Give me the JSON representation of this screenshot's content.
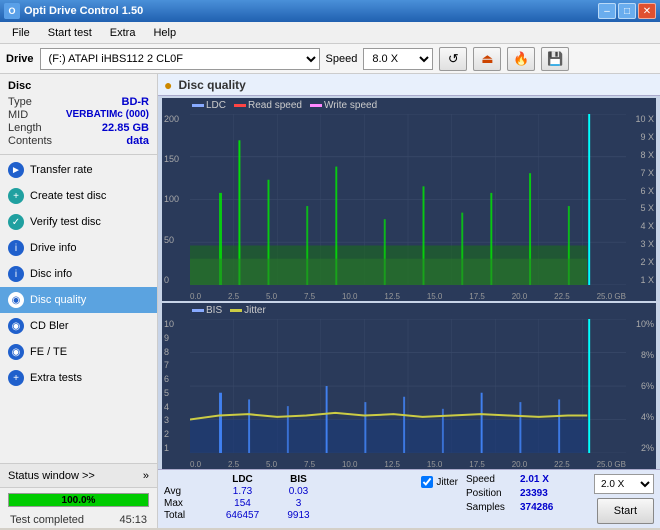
{
  "titlebar": {
    "icon": "●",
    "title": "Opti Drive Control 1.50",
    "min": "–",
    "max": "□",
    "close": "✕"
  },
  "menu": {
    "items": [
      "File",
      "Start test",
      "Extra",
      "Help"
    ]
  },
  "drive": {
    "label": "Drive",
    "drive_value": "(F:)  ATAPI iHBS112  2 CL0F",
    "speed_label": "Speed",
    "speed_value": "8.0 X"
  },
  "disc": {
    "title": "Disc",
    "fields": [
      {
        "key": "Type",
        "val": "BD-R"
      },
      {
        "key": "MID",
        "val": "VERBATIMc (000)"
      },
      {
        "key": "Length",
        "val": "22.85 GB"
      },
      {
        "key": "Contents",
        "val": "data"
      }
    ]
  },
  "nav": {
    "items": [
      {
        "label": "Transfer rate",
        "icon": "►",
        "active": false
      },
      {
        "label": "Create test disc",
        "icon": "◉",
        "active": false
      },
      {
        "label": "Verify test disc",
        "icon": "◎",
        "active": false
      },
      {
        "label": "Drive info",
        "icon": "ℹ",
        "active": false
      },
      {
        "label": "Disc info",
        "icon": "ℹ",
        "active": false
      },
      {
        "label": "Disc quality",
        "icon": "◉",
        "active": true
      },
      {
        "label": "CD Bler",
        "icon": "◉",
        "active": false
      },
      {
        "label": "FE / TE",
        "icon": "◉",
        "active": false
      },
      {
        "label": "Extra tests",
        "icon": "◉",
        "active": false
      }
    ]
  },
  "status": {
    "btn_label": "Status window >>",
    "progress": 100,
    "progress_text": "100.0%",
    "completed": "Test completed",
    "time": "45:13"
  },
  "chart": {
    "title": "Disc quality",
    "top": {
      "legend": [
        {
          "label": "LDC",
          "color": "#88aaff"
        },
        {
          "label": "Read speed",
          "color": "#ff4444"
        },
        {
          "label": "Write speed",
          "color": "#ff88ff"
        }
      ],
      "y_left": [
        "200",
        "150",
        "100",
        "50",
        "0"
      ],
      "y_right": [
        "10 X",
        "9 X",
        "8 X",
        "7 X",
        "6 X",
        "5 X",
        "4 X",
        "3 X",
        "2 X",
        "1 X"
      ],
      "x_labels": [
        "0.0",
        "2.5",
        "5.0",
        "7.5",
        "10.0",
        "12.5",
        "15.0",
        "17.5",
        "20.0",
        "22.5",
        "25.0 GB"
      ]
    },
    "bottom": {
      "legend": [
        {
          "label": "BIS",
          "color": "#88aaff"
        },
        {
          "label": "Jitter",
          "color": "#cccc44"
        }
      ],
      "y_left": [
        "10",
        "9",
        "8",
        "7",
        "6",
        "5",
        "4",
        "3",
        "2",
        "1"
      ],
      "y_right": [
        "10%",
        "8%",
        "6%",
        "4%",
        "2%"
      ],
      "x_labels": [
        "0.0",
        "2.5",
        "5.0",
        "7.5",
        "10.0",
        "12.5",
        "15.0",
        "17.5",
        "20.0",
        "22.5",
        "25.0 GB"
      ]
    }
  },
  "stats": {
    "headers": [
      "",
      "LDC",
      "BIS"
    ],
    "rows": [
      {
        "label": "Avg",
        "ldc": "1.73",
        "bis": "0.03"
      },
      {
        "label": "Max",
        "ldc": "154",
        "bis": "3"
      },
      {
        "label": "Total",
        "ldc": "646457",
        "bis": "9913"
      }
    ],
    "jitter_label": "Jitter",
    "speed_label": "Speed",
    "speed_val": "2.01 X",
    "speed_select": "2.0 X",
    "position_label": "Position",
    "position_val": "23393",
    "samples_label": "Samples",
    "samples_val": "374286",
    "start_btn": "Start"
  }
}
